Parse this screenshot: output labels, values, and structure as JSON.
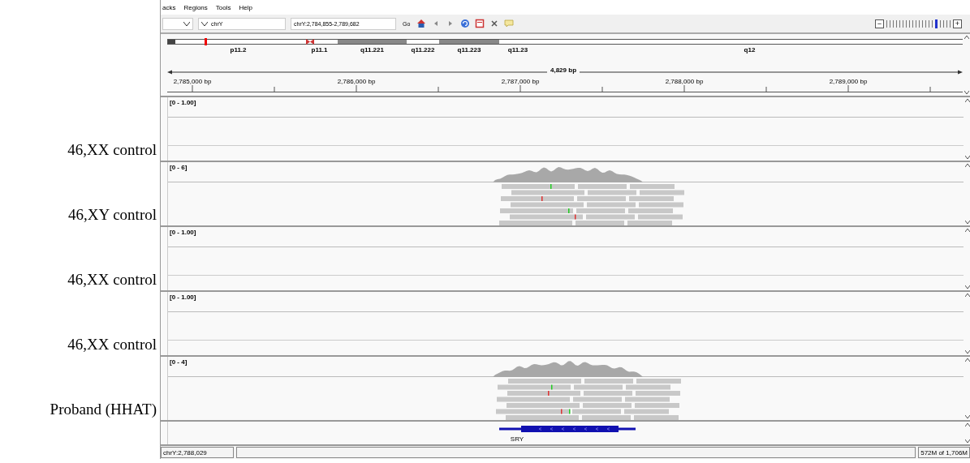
{
  "menu": [
    {
      "label": "acks"
    },
    {
      "label": "Regions"
    },
    {
      "label": "Tools"
    },
    {
      "label": "Help"
    }
  ],
  "toolbar": {
    "chromosome": "chrY",
    "locus": "chrY:2,784,855-2,789,682",
    "go": "Go",
    "zoom": {
      "minus": "−",
      "plus": "+",
      "level": 0.8
    }
  },
  "ruler": {
    "cytobands": [
      {
        "kind": "gvar"
      },
      {
        "kind": "gneg",
        "label": "p11.2"
      },
      {
        "kind": "acen",
        "label": "p11.1"
      },
      {
        "kind": "gpos",
        "label": "q11.221"
      },
      {
        "kind": "gneg",
        "label": "q11.222"
      },
      {
        "kind": "gpos",
        "label": "q11.223"
      },
      {
        "kind": "gneg",
        "label": "q11.23"
      },
      {
        "kind": "gneg",
        "label": "q12"
      }
    ],
    "span": "4,829 bp",
    "ticks": [
      "2,785,000 bp",
      "2,786,000 bp",
      "2,787,000 bp",
      "2,788,000 bp",
      "2,789,000 bp"
    ]
  },
  "samples": [
    {
      "label": "46,XX control",
      "range": "[0 - 1.00]",
      "kind": "empty"
    },
    {
      "label": "46,XY control",
      "range": "[0 - 6]",
      "kind": "aligned"
    },
    {
      "label": "46,XX control",
      "range": "[0 - 1.00]",
      "kind": "empty"
    },
    {
      "label": "46,XX control",
      "range": "[0 - 1.00]",
      "kind": "empty"
    },
    {
      "label": "Proband (HHAT)",
      "range": "[0 - 4]",
      "kind": "aligned"
    }
  ],
  "gene_track": {
    "gene": "SRY"
  },
  "status_bar": {
    "position": "chrY:2,788,029",
    "memory": "572M of 1,706M"
  }
}
